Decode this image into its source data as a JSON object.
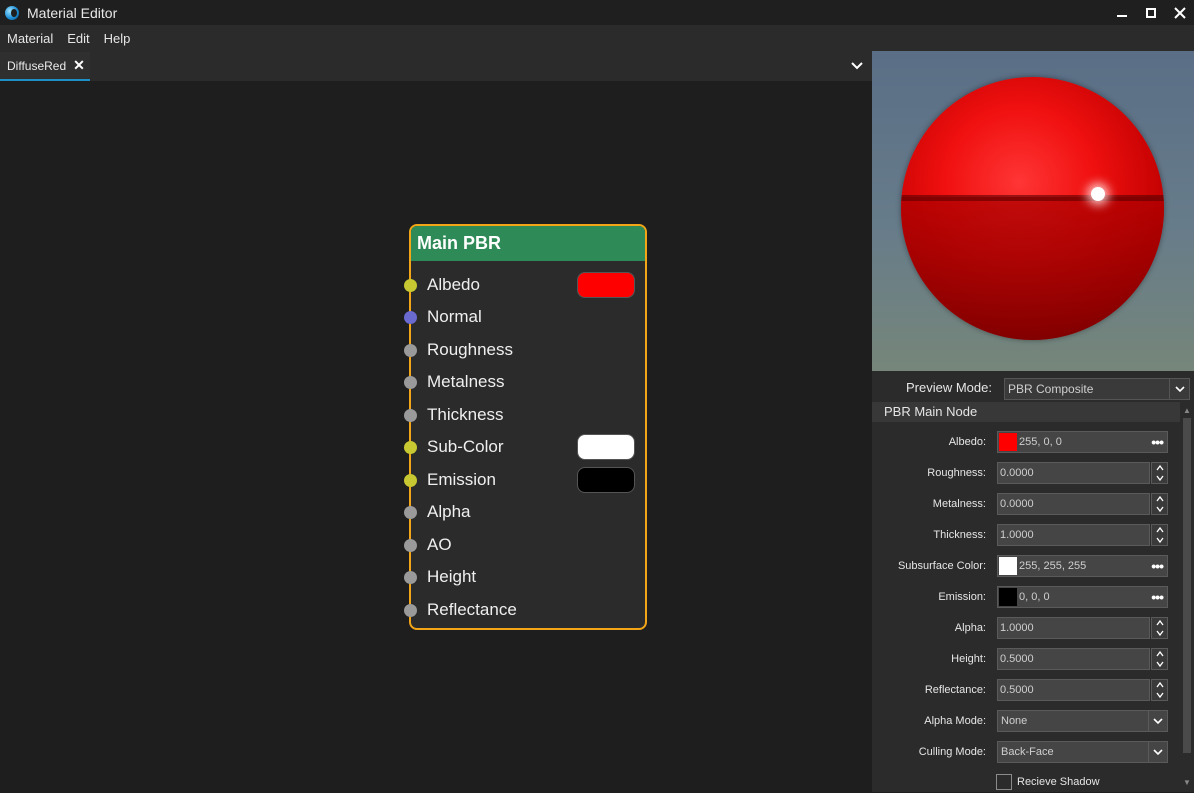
{
  "window": {
    "title": "Material Editor"
  },
  "menu": [
    "Material",
    "Edit",
    "Help"
  ],
  "tabs": [
    {
      "label": "DiffuseRed"
    }
  ],
  "node": {
    "title": "Main PBR",
    "header_color": "#2e8b57",
    "border_color": "#f2a516",
    "pins": [
      {
        "label": "Albedo",
        "pin_color": "#c8c832",
        "swatch": "#ff0000"
      },
      {
        "label": "Normal",
        "pin_color": "#6a6ad0",
        "swatch": null
      },
      {
        "label": "Roughness",
        "pin_color": "#9a9a9a",
        "swatch": null
      },
      {
        "label": "Metalness",
        "pin_color": "#9a9a9a",
        "swatch": null
      },
      {
        "label": "Thickness",
        "pin_color": "#9a9a9a",
        "swatch": null
      },
      {
        "label": "Sub-Color",
        "pin_color": "#c8c832",
        "swatch": "#ffffff"
      },
      {
        "label": "Emission",
        "pin_color": "#c8c832",
        "swatch": "#000000"
      },
      {
        "label": "Alpha",
        "pin_color": "#9a9a9a",
        "swatch": null
      },
      {
        "label": "AO",
        "pin_color": "#9a9a9a",
        "swatch": null
      },
      {
        "label": "Height",
        "pin_color": "#9a9a9a",
        "swatch": null
      },
      {
        "label": "Reflectance",
        "pin_color": "#9a9a9a",
        "swatch": null
      }
    ]
  },
  "preview": {
    "mode_label": "Preview Mode:",
    "mode_value": "PBR Composite"
  },
  "section": {
    "title": "PBR Main Node"
  },
  "properties": [
    {
      "label": "Albedo:",
      "type": "color",
      "swatch": "#ff0000",
      "value": "255, 0, 0"
    },
    {
      "label": "Roughness:",
      "type": "number",
      "value": "0.0000"
    },
    {
      "label": "Metalness:",
      "type": "number",
      "value": "0.0000"
    },
    {
      "label": "Thickness:",
      "type": "number",
      "value": "1.0000"
    },
    {
      "label": "Subsurface Color:",
      "type": "color",
      "swatch": "#ffffff",
      "value": "255, 255, 255"
    },
    {
      "label": "Emission:",
      "type": "color",
      "swatch": "#000000",
      "value": "0, 0, 0"
    },
    {
      "label": "Alpha:",
      "type": "number",
      "value": "1.0000"
    },
    {
      "label": "Height:",
      "type": "number",
      "value": "0.5000"
    },
    {
      "label": "Reflectance:",
      "type": "number",
      "value": "0.5000"
    },
    {
      "label": "Alpha Mode:",
      "type": "select",
      "value": "None"
    },
    {
      "label": "Culling Mode:",
      "type": "select",
      "value": "Back-Face"
    }
  ],
  "checkbox": {
    "label": "Recieve Shadow",
    "checked": false
  }
}
